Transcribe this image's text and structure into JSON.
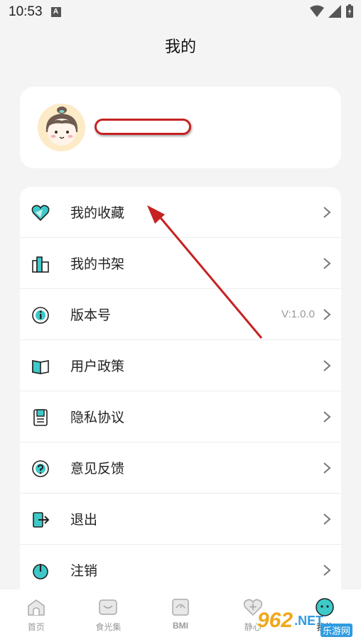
{
  "status": {
    "time": "10:53"
  },
  "header": {
    "title": "我的"
  },
  "menu": [
    {
      "id": "favorites",
      "label": "我的收藏",
      "icon": "heart-icon",
      "value": ""
    },
    {
      "id": "bookshelf",
      "label": "我的书架",
      "icon": "bookshelf-icon",
      "value": ""
    },
    {
      "id": "version",
      "label": "版本号",
      "icon": "info-icon",
      "value": "V:1.0.0"
    },
    {
      "id": "user-policy",
      "label": "用户政策",
      "icon": "book-icon",
      "value": ""
    },
    {
      "id": "privacy",
      "label": "隐私协议",
      "icon": "document-icon",
      "value": ""
    },
    {
      "id": "feedback",
      "label": "意见反馈",
      "icon": "question-icon",
      "value": ""
    },
    {
      "id": "logout",
      "label": "退出",
      "icon": "exit-icon",
      "value": ""
    },
    {
      "id": "deactivate",
      "label": "注销",
      "icon": "power-icon",
      "value": ""
    }
  ],
  "tabs": [
    {
      "label": "首页",
      "icon": "home-icon"
    },
    {
      "label": "食光集",
      "icon": "bowl-icon"
    },
    {
      "label": "BMI",
      "icon": "scale-icon"
    },
    {
      "label": "静心",
      "icon": "heart-plus-icon"
    },
    {
      "label": "我的",
      "icon": "mine-icon"
    }
  ],
  "watermark": {
    "brand": "962",
    "suffix": ".NET",
    "sub": "乐游网"
  },
  "colors": {
    "accent": "#3ec9c9",
    "annotation": "#c62222",
    "background": "#f4f4f4"
  }
}
